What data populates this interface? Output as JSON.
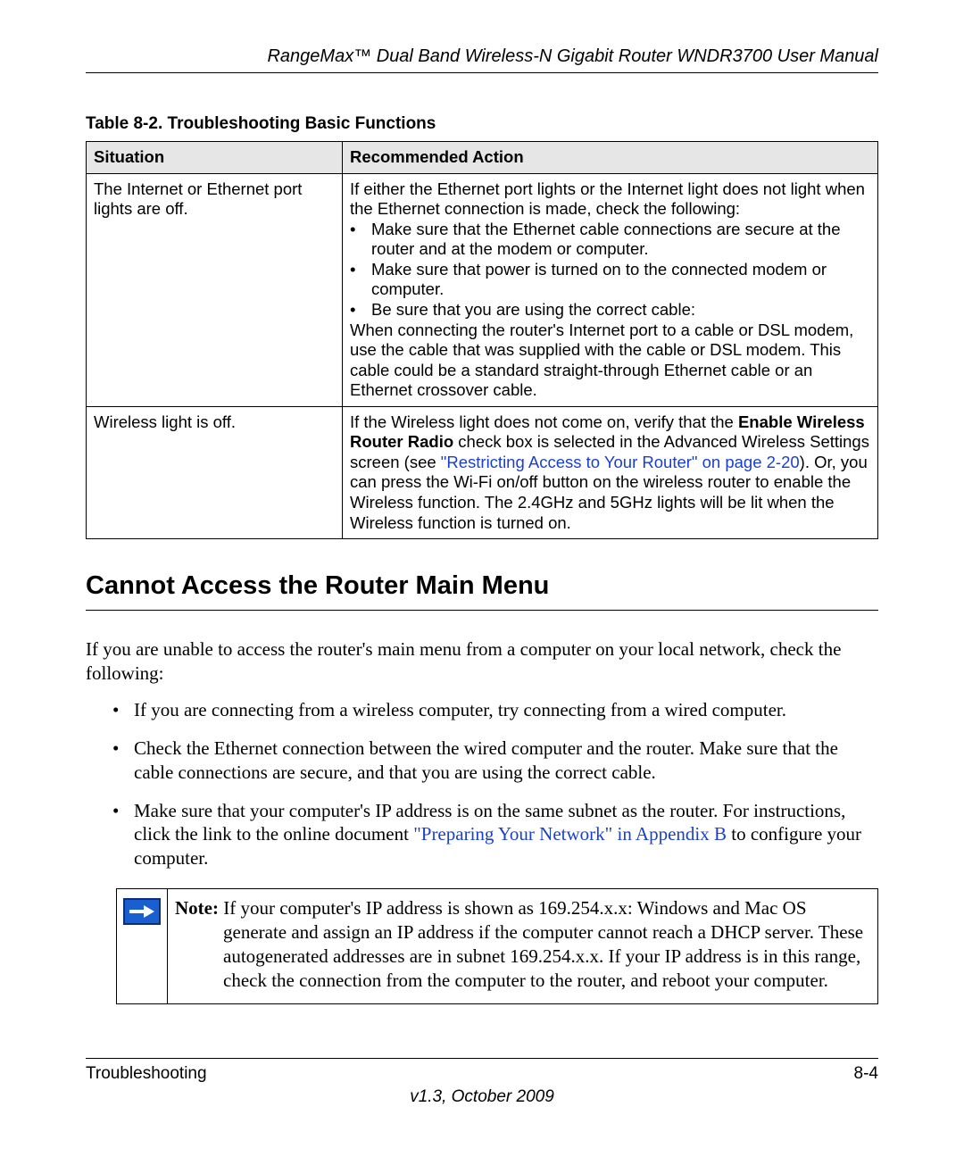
{
  "header": {
    "running_head": "RangeMax™ Dual Band Wireless-N Gigabit Router WNDR3700 User Manual"
  },
  "table": {
    "caption": "Table 8-2.  Troubleshooting Basic Functions",
    "headers": {
      "situation": "Situation",
      "action": "Recommended Action"
    },
    "rows": [
      {
        "situation": "The Internet or Ethernet port lights are off.",
        "action": {
          "intro": "If either the Ethernet port lights or the Internet light does not light when the Ethernet connection is made, check the following:",
          "bullets": [
            "Make sure that the Ethernet cable connections are secure at the router and at the modem or computer.",
            "Make sure that power is turned on to the connected modem or computer.",
            "Be sure that you are using the correct cable:"
          ],
          "trailing": "When connecting the router's Internet port to a cable or DSL modem, use the cable that was supplied with the cable or DSL modem. This cable could be a standard straight-through Ethernet cable or an Ethernet crossover cable."
        }
      },
      {
        "situation": "Wireless light is off.",
        "action": {
          "pre": "If the Wireless light does not come on, verify that the ",
          "bold": "Enable Wireless Router Radio",
          "mid": " check box is selected in the Advanced Wireless Settings screen (see ",
          "link": "\"Restricting Access to Your Router\" on page 2-20",
          "post": "). Or, you can press the Wi-Fi on/off button on the wireless router to enable the Wireless function. The 2.4GHz and 5GHz lights will be lit when the Wireless function is turned on."
        }
      }
    ]
  },
  "section": {
    "title": "Cannot Access the Router Main Menu",
    "intro": "If you are unable to access the router's main menu from a computer on your local network, check the following:",
    "bullets": [
      {
        "text": "If you are connecting from a wireless computer, try connecting from a wired computer."
      },
      {
        "text": "Check the Ethernet connection between the wired computer and the router. Make sure that the cable connections are secure, and that you are using the correct cable."
      },
      {
        "pre": "Make sure that your computer's IP address is on the same subnet as the router. For instructions, click the link to the online document ",
        "link": "\"Preparing Your Network\" in Appendix B",
        "post": " to configure your computer."
      }
    ],
    "note": {
      "label": "Note:",
      "first_line": " If your computer's IP address is shown as 169.254.x.x: Windows and Mac OS",
      "rest": "generate and assign an IP address if the computer cannot reach a DHCP server. These autogenerated addresses are in subnet 169.254.x.x. If your IP address is in this range, check the connection from the computer to the router, and reboot your computer."
    }
  },
  "footer": {
    "section": "Troubleshooting",
    "page": "8-4",
    "version": "v1.3, October 2009"
  }
}
